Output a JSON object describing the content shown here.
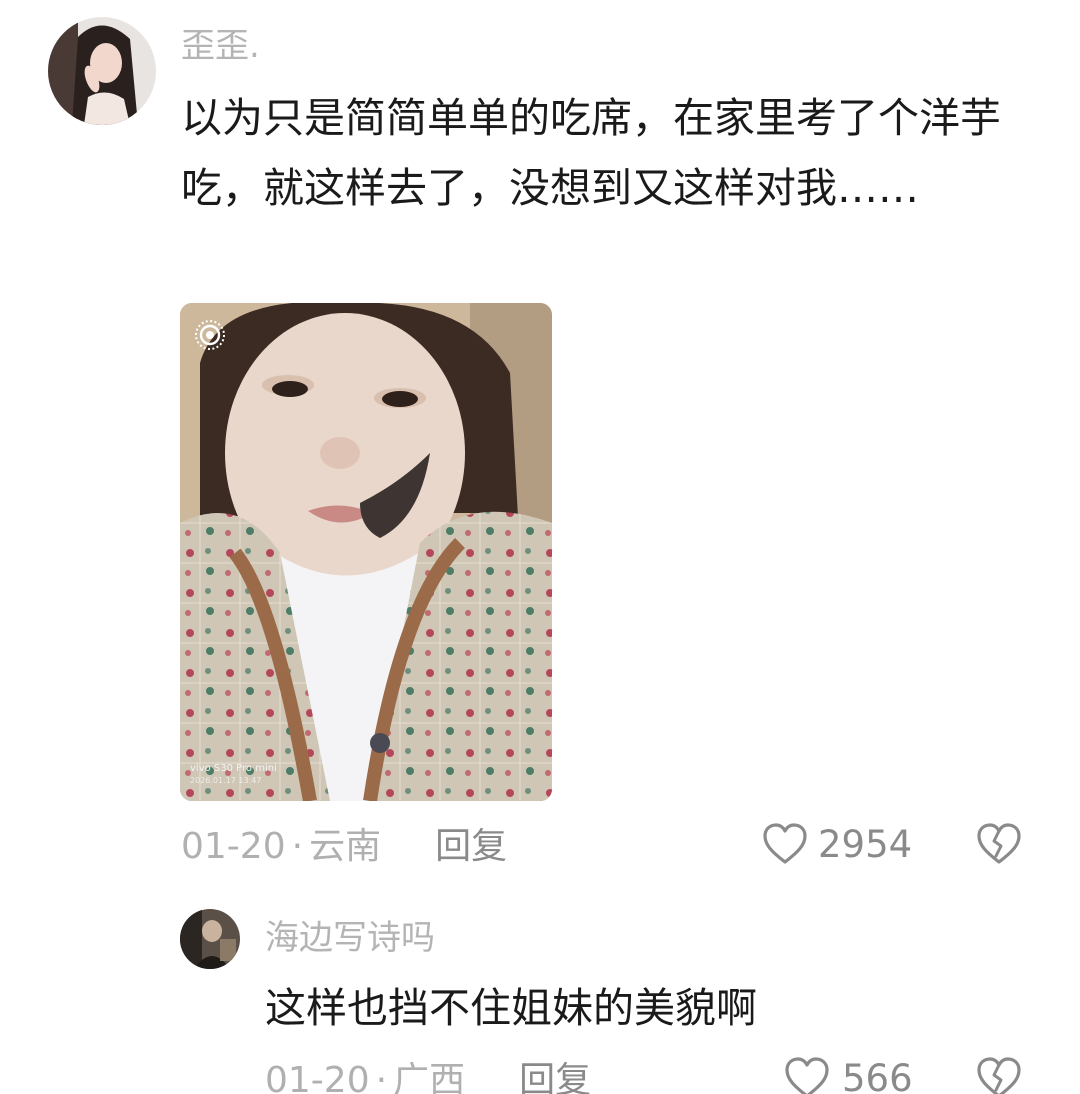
{
  "comments": [
    {
      "username": "歪歪.",
      "text": "以为只是简简单单的吃席，在家里考了个洋芋吃，就这样去了，没想到又这样对我……",
      "photo": {
        "watermark_model": "vivo S30 Pro mini",
        "watermark_time": "2026.01.17 13:47"
      },
      "date": "01-20",
      "separator": "·",
      "location": "云南",
      "reply_label": "回复",
      "likes": "2954"
    },
    {
      "username": "海边写诗吗",
      "text": "这样也挡不住姐妹的美貌啊",
      "date": "01-20",
      "separator": "·",
      "location": "广西",
      "reply_label": "回复",
      "likes": "566"
    }
  ],
  "icons": {
    "like": "heart-outline-icon",
    "dislike": "broken-heart-icon",
    "camera": "live-photo-icon"
  },
  "colors": {
    "username": "#b4b4b4",
    "text": "#1a1a1a",
    "meta": "#b0b0b0",
    "icon": "#8a8a8a"
  }
}
